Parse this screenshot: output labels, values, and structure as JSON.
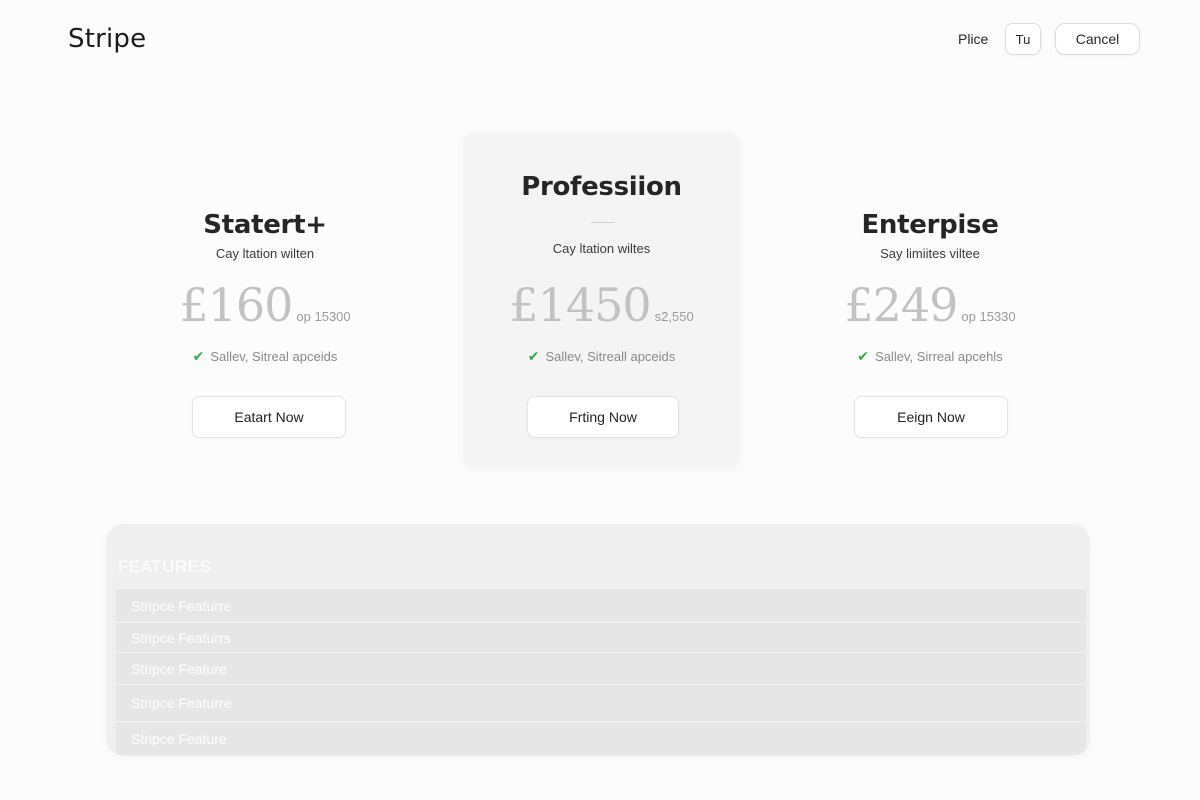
{
  "app": {
    "logo": "Stripe"
  },
  "header": {
    "nav_link": "Plice",
    "small_button": "Tu",
    "cancel_button": "Cancel"
  },
  "plans": [
    {
      "name": "Statert+",
      "subtitle": "Cay ltation wilten",
      "price": "£160",
      "price_note": "op 15300",
      "feature": "Sallev, Sitreal apceids",
      "cta": "Eatart Now"
    },
    {
      "name": "Professiion",
      "subtitle": "Cay ltation wiltes",
      "price": "£1450",
      "price_note": "s2,550",
      "feature": "Sallev, Sitreall apceids",
      "cta": "Frting Now"
    },
    {
      "name": "Enterpise",
      "subtitle": "Say limiites viltee",
      "price": "£249",
      "price_note": "op 15330",
      "feature": "Sallev, Sirreal apcehls",
      "cta": "Eeign Now"
    }
  ],
  "features": {
    "title": "FEATURES",
    "rows": [
      "Stripce Featurre",
      "Stripce Featurrs",
      "Stripce Feature",
      "Stripce Featurre",
      "Stripce Feature"
    ]
  },
  "colors": {
    "check": "#2faa44",
    "price": "#c2c2c2",
    "highlight_card": "#f4f4f4"
  },
  "icons": {
    "feature_check": "check-icon"
  }
}
